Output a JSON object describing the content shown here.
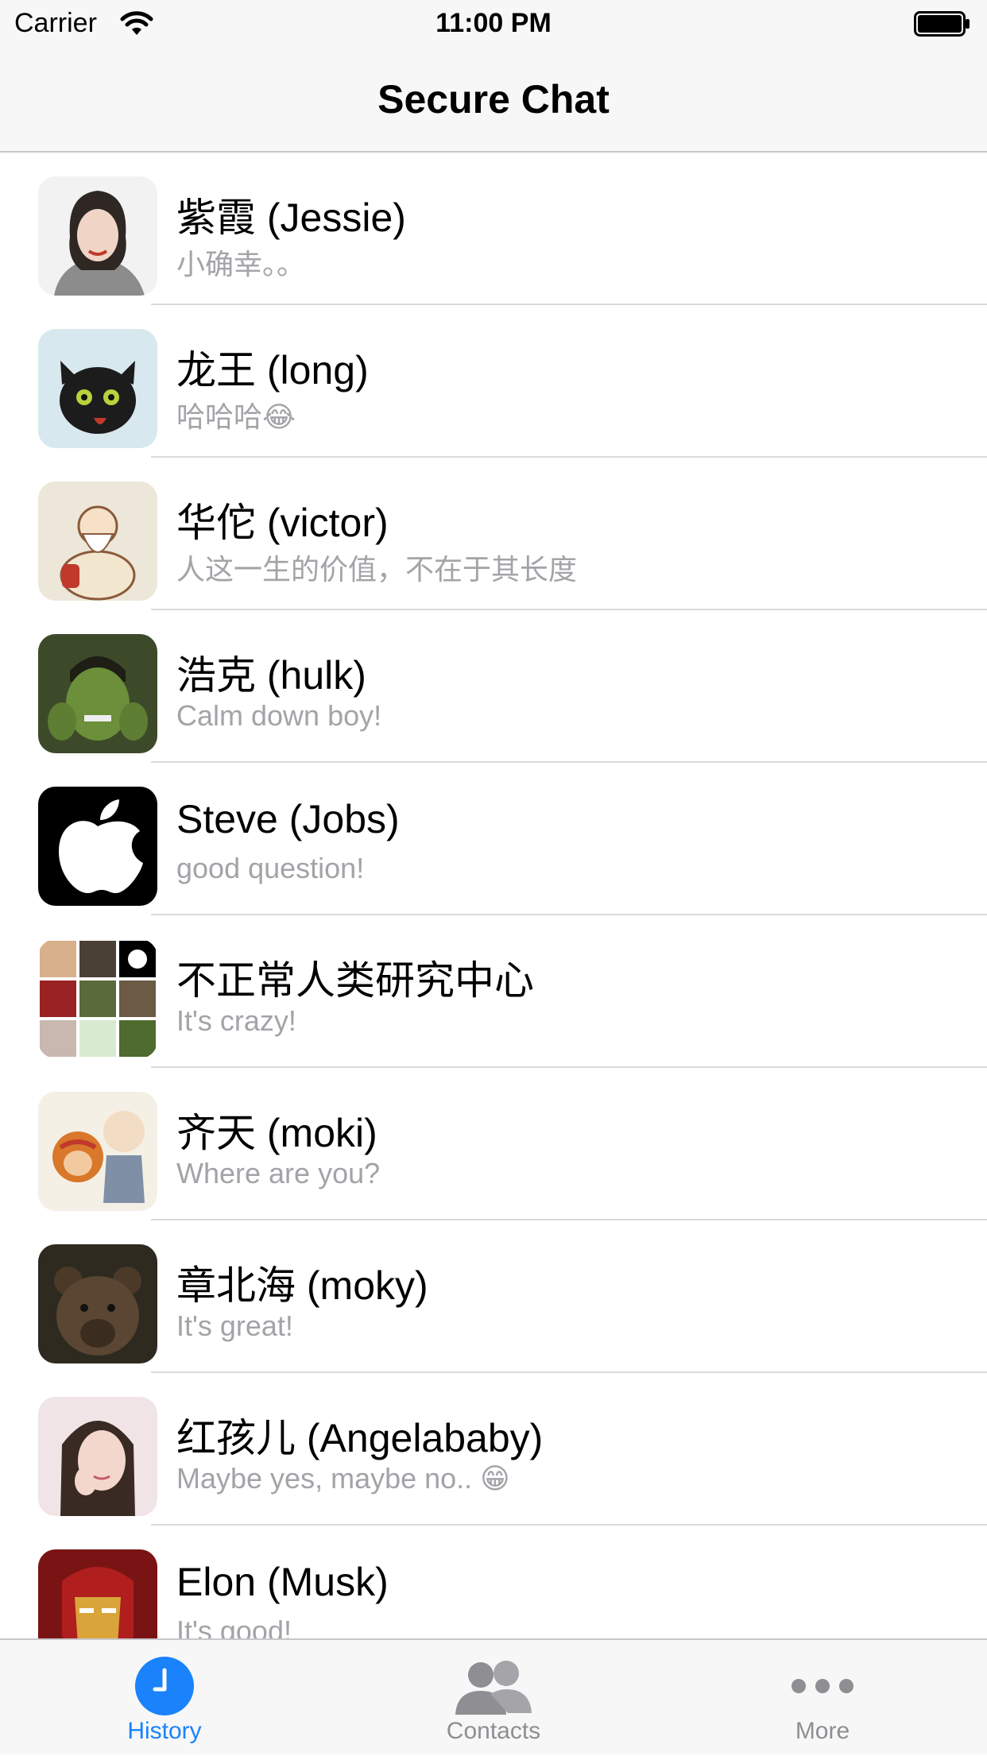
{
  "status_bar": {
    "carrier": "Carrier",
    "time": "11:00 PM"
  },
  "nav": {
    "title": "Secure Chat"
  },
  "chats": [
    {
      "name": "紫霞 (Jessie)",
      "message": "小确幸。。",
      "avatar": "woman-portrait-avatar"
    },
    {
      "name": "龙王 (long)",
      "message": "哈哈哈😂",
      "avatar": "black-dragon-avatar"
    },
    {
      "name": "华佗 (victor)",
      "message": "人这一生的价值，不在于其长度",
      "avatar": "old-sage-avatar"
    },
    {
      "name": "浩克 (hulk)",
      "message": "Calm down boy!",
      "avatar": "hulk-avatar"
    },
    {
      "name": "Steve (Jobs)",
      "message": "good question!",
      "avatar": "apple-logo-avatar"
    },
    {
      "name": "不正常人类研究中心",
      "message": "It's crazy!",
      "avatar": "group-grid-avatar"
    },
    {
      "name": "齐天 (moki)",
      "message": "Where are you?",
      "avatar": "monkey-king-avatar"
    },
    {
      "name": "章北海 (moky)",
      "message": "It's great!",
      "avatar": "bear-avatar"
    },
    {
      "name": "红孩儿 (Angelababy)",
      "message": "Maybe yes, maybe no.. 😁",
      "avatar": "woman-pose-avatar"
    },
    {
      "name": "Elon (Musk)",
      "message": "It's good!",
      "avatar": "iron-man-avatar"
    }
  ],
  "tabs": [
    {
      "label": "History",
      "icon": "clock-icon",
      "active": true
    },
    {
      "label": "Contacts",
      "icon": "contacts-icon",
      "active": false
    },
    {
      "label": "More",
      "icon": "more-dots-icon",
      "active": false
    }
  ],
  "colors": {
    "accent": "#1a82fb",
    "inactive": "#8e8e93",
    "subtitle": "#a3a3a8",
    "divider": "#d9d9de"
  }
}
